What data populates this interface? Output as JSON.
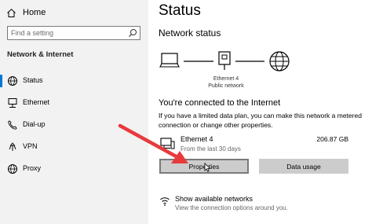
{
  "sidebar": {
    "home": {
      "icon": "home-icon",
      "label": "Home"
    },
    "search": {
      "placeholder": "Find a setting",
      "icon": "search-icon"
    },
    "section_title": "Network & Internet",
    "items": [
      {
        "label": "Status",
        "icon": "globe-status-icon",
        "active": true
      },
      {
        "label": "Ethernet",
        "icon": "ethernet-icon",
        "active": false
      },
      {
        "label": "Dial-up",
        "icon": "dialup-icon",
        "active": false
      },
      {
        "label": "VPN",
        "icon": "vpn-icon",
        "active": false
      },
      {
        "label": "Proxy",
        "icon": "globe-icon",
        "active": false
      }
    ]
  },
  "main": {
    "title": "Status",
    "subtitle": "Network status",
    "diagram": {
      "adapter_name": "Ethernet 4",
      "network_type": "Public network",
      "icons": [
        "computer-icon",
        "ethernet-adapter-icon",
        "globe-icon"
      ]
    },
    "connected_heading": "You're connected to the Internet",
    "description": "If you have a limited data plan, you can make this network a metered connection or change other properties.",
    "connection": {
      "name": "Ethernet 4",
      "period": "From the last 30 days",
      "usage": "206.87 GB",
      "icon": "connection-computer-icon"
    },
    "buttons": {
      "properties": "Properties",
      "data_usage": "Data usage"
    },
    "show_networks": {
      "title": "Show available networks",
      "subtitle": "View the connection options around you.",
      "icon": "wifi-network-icon"
    }
  },
  "colors": {
    "sidebar_bg": "#f2f2f2",
    "accent": "#0078d7",
    "arrow": "#e8393c",
    "button_bg": "#cccccc"
  }
}
